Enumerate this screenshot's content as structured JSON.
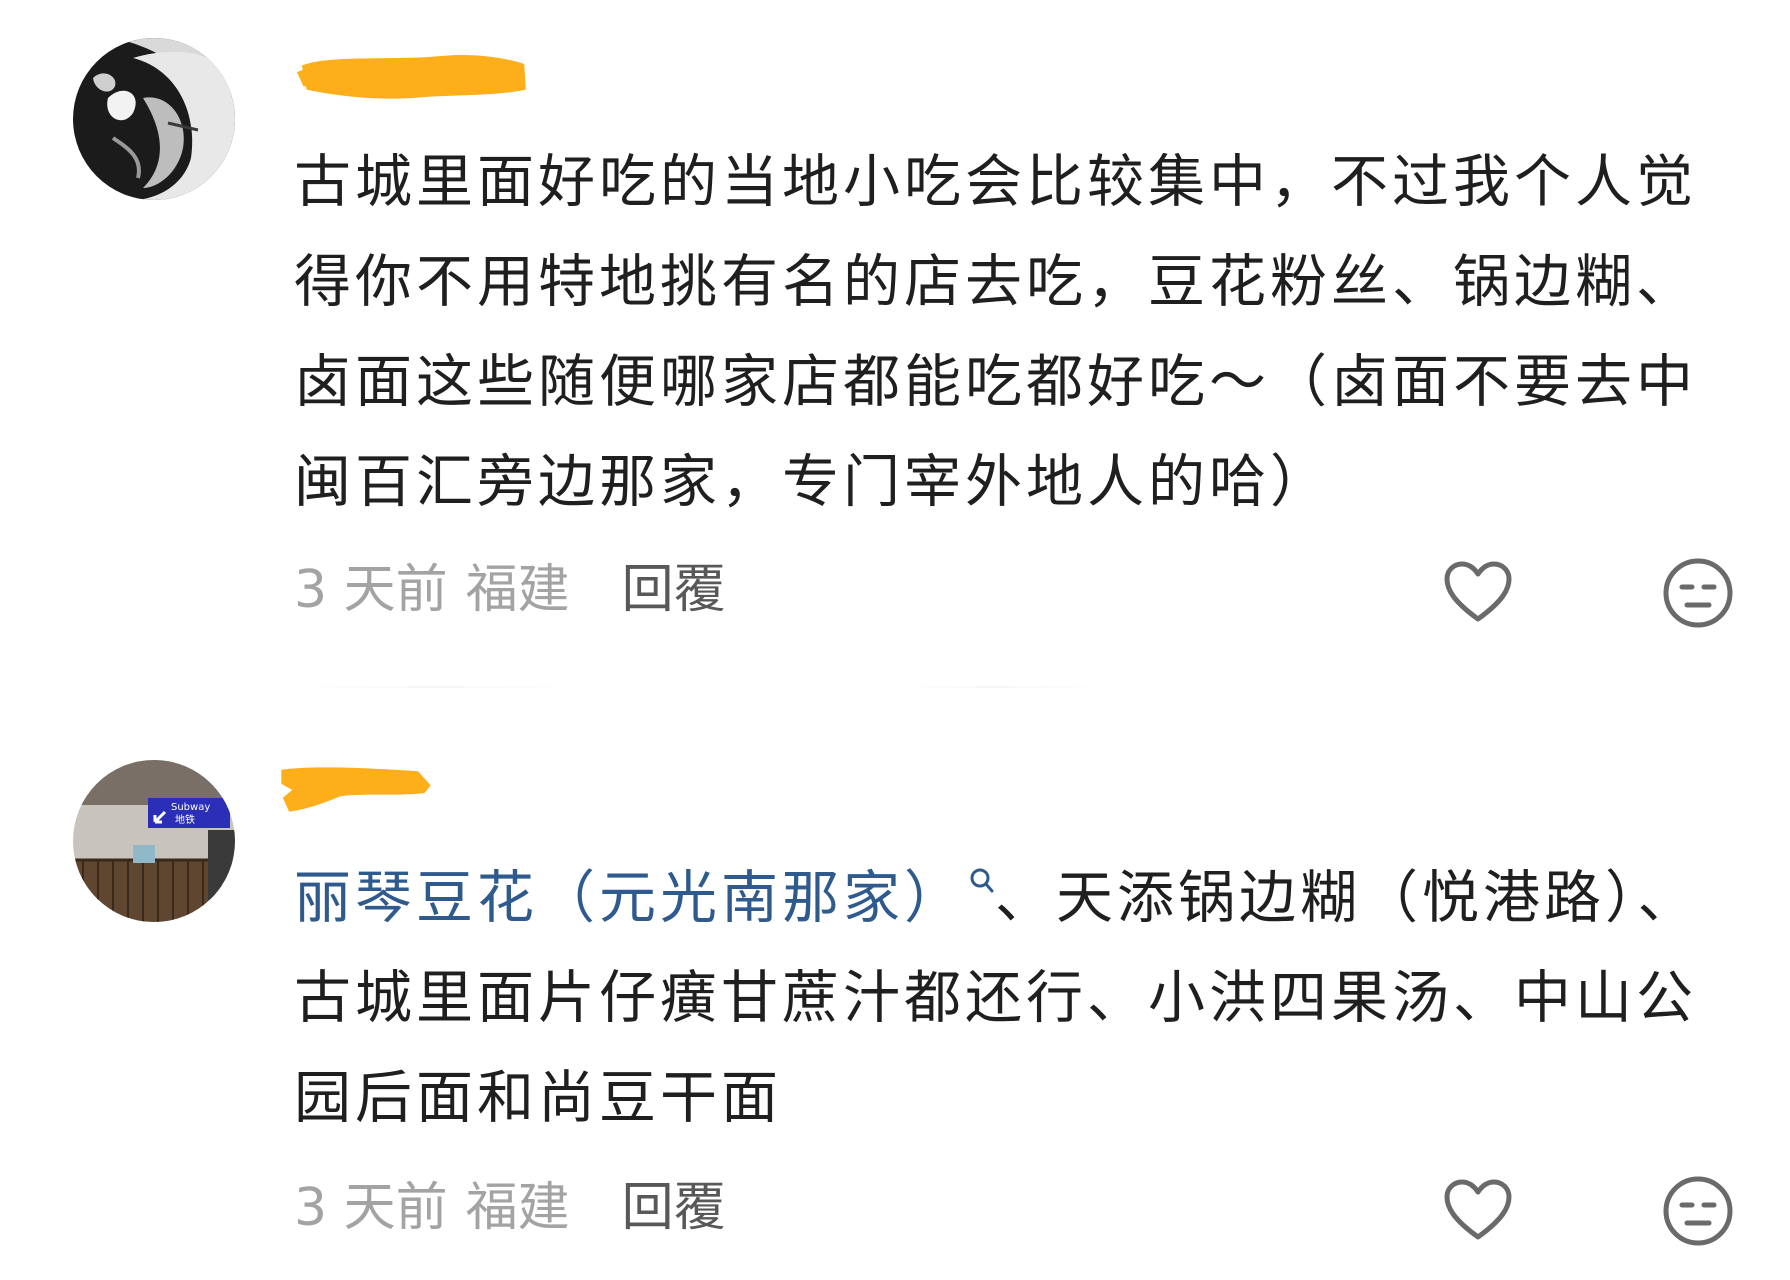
{
  "comments": [
    {
      "avatar_icon": "anime-character-avatar",
      "username_redacted": true,
      "text": "古城里面好吃的当地小吃会比较集中，不过我个人觉得你不用特地挑有名的店去吃，豆花粉丝、锅边糊、卤面这些随便哪家店都能吃都好吃～（卤面不要去中闽百汇旁边那家，专门宰外地人的哈）",
      "time": "3 天前",
      "location": "福建",
      "reply_label": "回覆",
      "like_icon": "heart-outline-icon",
      "react_icon": "meh-face-icon"
    },
    {
      "avatar_icon": "subway-station-avatar",
      "avatar_sign_text": "Subway",
      "avatar_sign_text_cn": "地铁",
      "username_redacted": true,
      "link_text": "丽琴豆花（元光南那家）",
      "text_after_link": "、天添锅边糊（悦港路）、古城里面片仔癀甘蔗汁都还行、小洪四果汤、中山公园后面和尚豆干面",
      "time": "3 天前",
      "location": "福建",
      "reply_label": "回覆",
      "like_icon": "heart-outline-icon",
      "react_icon": "meh-face-icon"
    }
  ],
  "colors": {
    "redaction": "#fcae1b",
    "link": "#2f5a8e",
    "meta": "#a3a3a3",
    "reply": "#585858",
    "icon": "#6a6a6a"
  }
}
